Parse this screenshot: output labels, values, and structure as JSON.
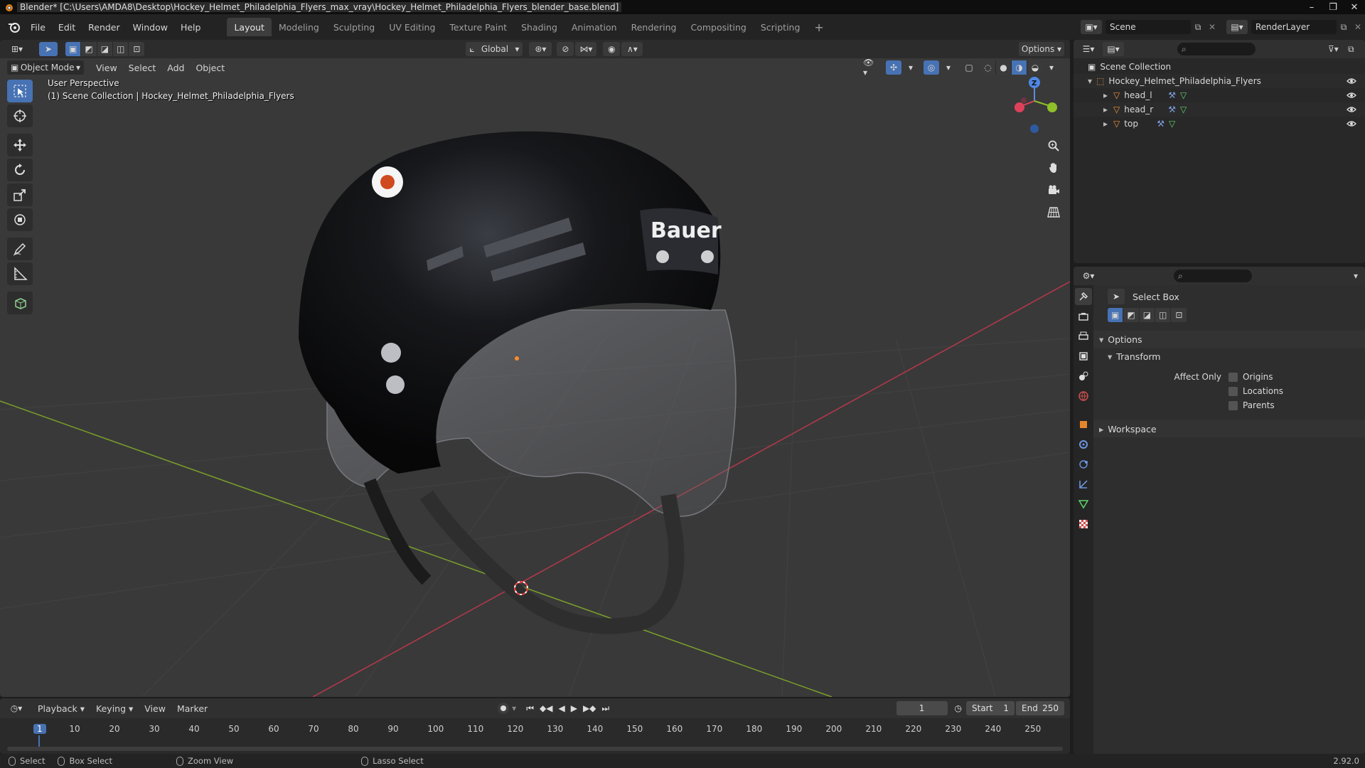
{
  "titlebar": {
    "title": "Blender* [C:\\Users\\AMDA8\\Desktop\\Hockey_Helmet_Philadelphia_Flyers_max_vray\\Hockey_Helmet_Philadelphia_Flyers_blender_base.blend]"
  },
  "menu": {
    "items": [
      "File",
      "Edit",
      "Render",
      "Window",
      "Help"
    ],
    "workspaces": [
      "Layout",
      "Modeling",
      "Sculpting",
      "UV Editing",
      "Texture Paint",
      "Shading",
      "Animation",
      "Rendering",
      "Compositing",
      "Scripting"
    ],
    "active_workspace": "Layout",
    "add_tab": "+",
    "scene_name": "Scene",
    "view_layer": "RenderLayer"
  },
  "viewport": {
    "transform_orientation": "Global",
    "options_label": "Options",
    "mode": "Object Mode",
    "menus": [
      "View",
      "Select",
      "Add",
      "Object"
    ],
    "info_line1": "User Perspective",
    "info_line2": "(1) Scene Collection | Hockey_Helmet_Philadelphia_Flyers",
    "helmet_brand": "Bauer",
    "gizmo_z": "Z"
  },
  "outliner": {
    "root": "Scene Collection",
    "collection": "Hockey_Helmet_Philadelphia_Flyers",
    "objects": [
      "head_l",
      "head_r",
      "top"
    ]
  },
  "properties": {
    "tool_name": "Select Box",
    "options_label": "Options",
    "transform_label": "Transform",
    "affect_only_label": "Affect Only",
    "checkboxes": [
      "Origins",
      "Locations",
      "Parents"
    ],
    "workspace_label": "Workspace"
  },
  "timeline": {
    "menus": [
      "Playback",
      "Keying",
      "View",
      "Marker"
    ],
    "current_frame": "1",
    "start_label": "Start",
    "start_value": "1",
    "end_label": "End",
    "end_value": "250",
    "ticks": [
      "1",
      "10",
      "20",
      "30",
      "40",
      "50",
      "60",
      "70",
      "80",
      "90",
      "100",
      "110",
      "120",
      "130",
      "140",
      "150",
      "160",
      "170",
      "180",
      "190",
      "200",
      "210",
      "220",
      "230",
      "240",
      "250"
    ]
  },
  "statusbar": {
    "items": [
      "Select",
      "Box Select",
      "Zoom View",
      "Lasso Select"
    ],
    "version": "2.92.0"
  },
  "colors": {
    "accent": "#4772b3",
    "x_axis": "#b8384a",
    "y_axis": "#7aa12a"
  }
}
